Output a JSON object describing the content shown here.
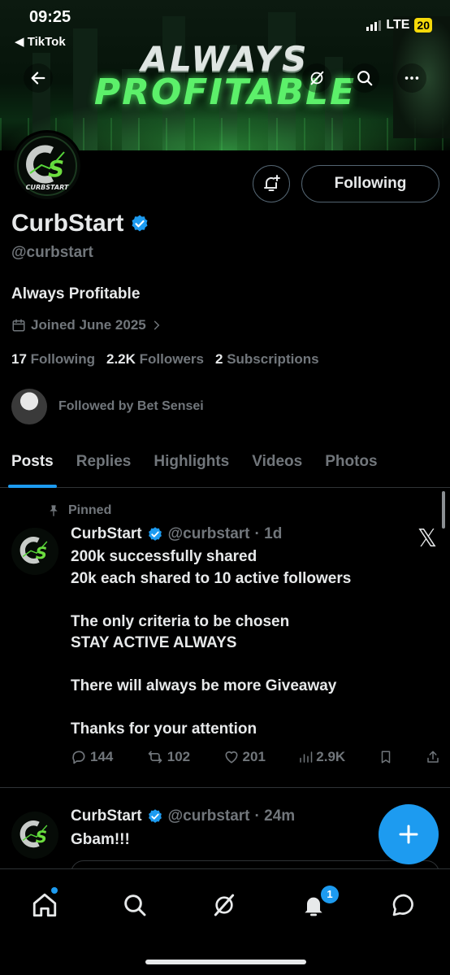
{
  "status_bar": {
    "time": "09:25",
    "back_app": "◀ TikTok",
    "network": "LTE",
    "battery": "20"
  },
  "banner": {
    "line1": "ALWAYS",
    "line2": "PROFITABLE"
  },
  "profile": {
    "display_name": "CurbStart",
    "handle": "@curbstart",
    "bio": "Always Profitable",
    "joined": "Joined June 2025",
    "following_count": "17",
    "following_label": "Following",
    "followers_count": "2.2K",
    "followers_label": "Followers",
    "subscriptions_count": "2",
    "subscriptions_label": "Subscriptions",
    "followed_by": "Followed by Bet Sensei",
    "follow_button": "Following",
    "avatar_text": "CURBSTART"
  },
  "tabs": [
    "Posts",
    "Replies",
    "Highlights",
    "Videos",
    "Photos"
  ],
  "posts": [
    {
      "pinned_label": "Pinned",
      "name": "CurbStart",
      "handle": "@curbstart",
      "time": "· 1d",
      "text": "200k successfully shared\n20k each shared to 10 active followers\n\nThe only criteria to be chosen\nSTAY ACTIVE ALWAYS\n\nThere will always be more Giveaway\n\nThanks for your attention",
      "replies": "144",
      "reposts": "102",
      "likes": "201",
      "views": "2.9K"
    },
    {
      "name": "CurbStart",
      "handle": "@curbstart",
      "time": "· 24m",
      "text": "Gbam!!!"
    }
  ],
  "bottom_nav": {
    "notifications_badge": "1"
  },
  "colors": {
    "accent": "#1d9bf0",
    "muted": "#71767b",
    "text": "#e7e9ea",
    "background": "#000000",
    "border": "#2f3336",
    "banner_green": "#5cf06a"
  }
}
